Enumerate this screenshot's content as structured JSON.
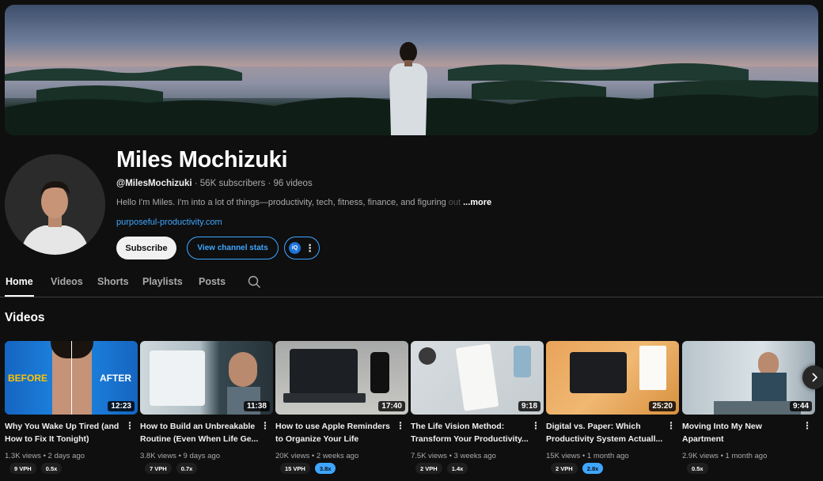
{
  "channel": {
    "name": "Miles Mochizuki",
    "handle": "@MilesMochizuki",
    "meta": "· 56K subscribers · 96 videos",
    "description_main": "Hello I'm Miles. I'm into a lot of things—productivity, tech, fitness, finance, and figuring",
    "description_fade": " out",
    "more_label": "...more",
    "link": "purposeful-productivity.com"
  },
  "buttons": {
    "subscribe": "Subscribe",
    "view_stats": "View channel stats",
    "ext_badge": "iQ"
  },
  "tabs": [
    "Home",
    "Videos",
    "Shorts",
    "Playlists",
    "Posts"
  ],
  "section_title": "Videos",
  "videos": [
    {
      "title": "Why You Wake Up Tired (and How to Fix It Tonight)",
      "duration": "12:23",
      "stats": "1.3K views • 2 days ago",
      "vph": "9 VPH",
      "ratio": "0.5x",
      "hot": false,
      "before": "BEFORE",
      "after": "AFTER"
    },
    {
      "title": "How to Build an Unbreakable Routine (Even When Life Ge...",
      "duration": "11:38",
      "stats": "3.8K views • 9 days ago",
      "vph": "7 VPH",
      "ratio": "0.7x",
      "hot": false
    },
    {
      "title": "How to use Apple Reminders to Organize Your Life",
      "duration": "17:40",
      "stats": "20K views • 2 weeks ago",
      "vph": "15 VPH",
      "ratio": "3.8x",
      "hot": true
    },
    {
      "title": "The Life Vision Method: Transform Your Productivity...",
      "duration": "9:18",
      "stats": "7.5K views • 3 weeks ago",
      "vph": "2 VPH",
      "ratio": "1.4x",
      "hot": false
    },
    {
      "title": "Digital vs. Paper: Which Productivity System Actuall...",
      "duration": "25:20",
      "stats": "15K views • 1 month ago",
      "vph": "2 VPH",
      "ratio": "2.8x",
      "hot": true
    },
    {
      "title": "Moving Into My New Apartment",
      "duration": "9:44",
      "stats": "2.9K views • 1 month ago",
      "vph": "",
      "ratio": "0.5x",
      "hot": false
    }
  ]
}
